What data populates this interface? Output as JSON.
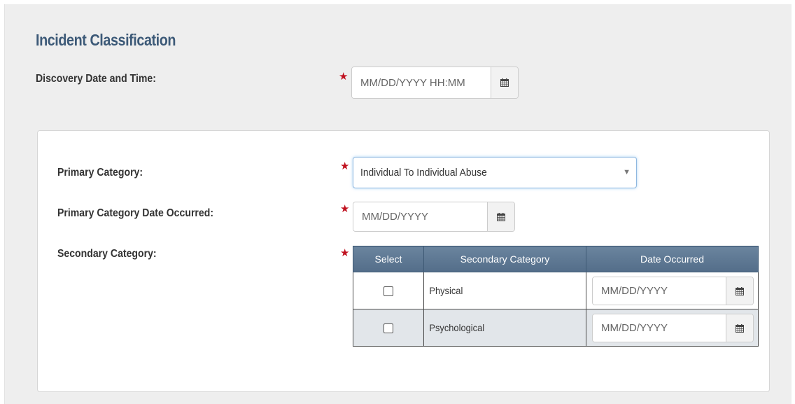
{
  "section": {
    "title": "Incident Classification"
  },
  "discovery": {
    "label": "Discovery Date and Time:",
    "placeholder": "MM/DD/YYYY HH:MM"
  },
  "primary_category": {
    "label": "Primary Category:",
    "selected": "Individual To Individual Abuse"
  },
  "primary_date": {
    "label": "Primary Category Date Occurred:",
    "placeholder": "MM/DD/YYYY"
  },
  "secondary": {
    "label": "Secondary Category:",
    "columns": [
      "Select",
      "Secondary Category",
      "Date Occurred"
    ],
    "rows": [
      {
        "category": "Physical",
        "date_placeholder": "MM/DD/YYYY",
        "checked": false
      },
      {
        "category": "Psychological",
        "date_placeholder": "MM/DD/YYYY",
        "checked": false
      }
    ]
  },
  "icons": {
    "required": "required-asterisk-icon",
    "calendar": "calendar-icon",
    "dropdown": "chevron-down-icon"
  },
  "colors": {
    "title": "#3d5a78",
    "required": "#c0111f",
    "table_header": "#5e7893",
    "focus_border": "#8fb8e0",
    "alt_row": "#e2e6ea"
  }
}
